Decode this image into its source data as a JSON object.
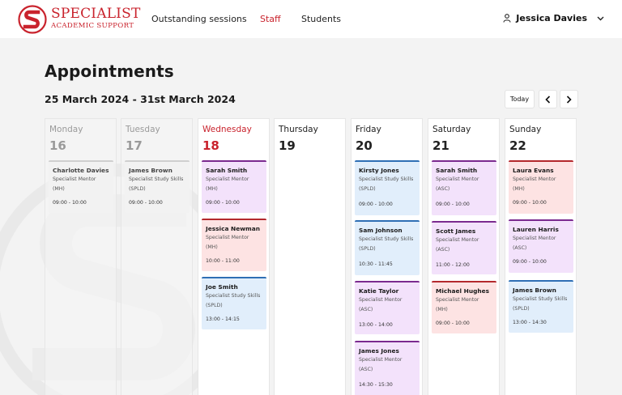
{
  "header": {
    "brand_line1": "SPECIALIST",
    "brand_line2": "ACADEMIC SUPPORT",
    "nav": [
      "Outstanding sessions",
      "Staff",
      "Students"
    ],
    "active_nav": "Staff",
    "user_name": "Jessica Davies"
  },
  "page": {
    "title": "Appointments",
    "date_range": "25 March 2024 - 31st March 2024",
    "today_label": "Today"
  },
  "colors": {
    "brand": "#c9232d",
    "mh": "#f3e2fb",
    "pink": "#fde3e3",
    "splt": "#e1eefb"
  },
  "days": [
    {
      "name": "Monday",
      "num": "16",
      "state": "past",
      "appointments": [
        {
          "name": "Charlotte Davies",
          "role": "Specialist Mentor (MH)",
          "time": "09:00 - 10:00",
          "color": "grey"
        }
      ]
    },
    {
      "name": "Tuesday",
      "num": "17",
      "state": "past",
      "appointments": [
        {
          "name": "James Brown",
          "role": "Specialist Study Skills (SPLD)",
          "time": "09:00 - 10:00",
          "color": "grey"
        }
      ]
    },
    {
      "name": "Wednesday",
      "num": "18",
      "state": "current",
      "appointments": [
        {
          "name": "Sarah Smith",
          "role": "Specialist Mentor (MH)",
          "time": "09:00 - 10:00",
          "color": "purple"
        },
        {
          "name": "Jessica Newman",
          "role": "Specialist Mentor (MH)",
          "time": "10:00 - 11:00",
          "color": "pink"
        },
        {
          "name": "Joe Smith",
          "role": "Specialist Study Skills (SPLD)",
          "time": "13:00 - 14:15",
          "color": "blue"
        }
      ]
    },
    {
      "name": "Thursday",
      "num": "19",
      "state": "future",
      "appointments": []
    },
    {
      "name": "Friday",
      "num": "20",
      "state": "future",
      "appointments": [
        {
          "name": "Kirsty Jones",
          "role": "Specialist Study Skills (SPLD)",
          "time": "09:00 - 10:00",
          "color": "blue"
        },
        {
          "name": "Sam Johnson",
          "role": "Specialist Study Skills (SPLD)",
          "time": "10:30 - 11:45",
          "color": "blue"
        },
        {
          "name": "Katie Taylor",
          "role": "Specialist Mentor (ASC)",
          "time": "13:00 - 14:00",
          "color": "purple"
        },
        {
          "name": "James Jones",
          "role": "Specialist Mentor (ASC)",
          "time": "14:30 - 15:30",
          "color": "purple"
        }
      ]
    },
    {
      "name": "Saturday",
      "num": "21",
      "state": "future",
      "appointments": [
        {
          "name": "Sarah Smith",
          "role": "Specialist Mentor (ASC)",
          "time": "09:00 - 10:00",
          "color": "purple"
        },
        {
          "name": "Scott James",
          "role": "Specialist Mentor (ASC)",
          "time": "11:00 - 12:00",
          "color": "purple"
        },
        {
          "name": "Michael Hughes",
          "role": "Specialist Mentor (MH)",
          "time": "09:00 - 10:00",
          "color": "pink"
        }
      ]
    },
    {
      "name": "Sunday",
      "num": "22",
      "state": "future",
      "appointments": [
        {
          "name": "Laura Evans",
          "role": "Specialist Mentor (MH)",
          "time": "09:00 - 10:00",
          "color": "pink"
        },
        {
          "name": "Lauren Harris",
          "role": "Specialist Mentor (ASC)",
          "time": "09:00 - 10:00",
          "color": "purple"
        },
        {
          "name": "James Brown",
          "role": "Specialist Study Skills (SPLD)",
          "time": "13:00 - 14:30",
          "color": "blue"
        }
      ]
    }
  ]
}
